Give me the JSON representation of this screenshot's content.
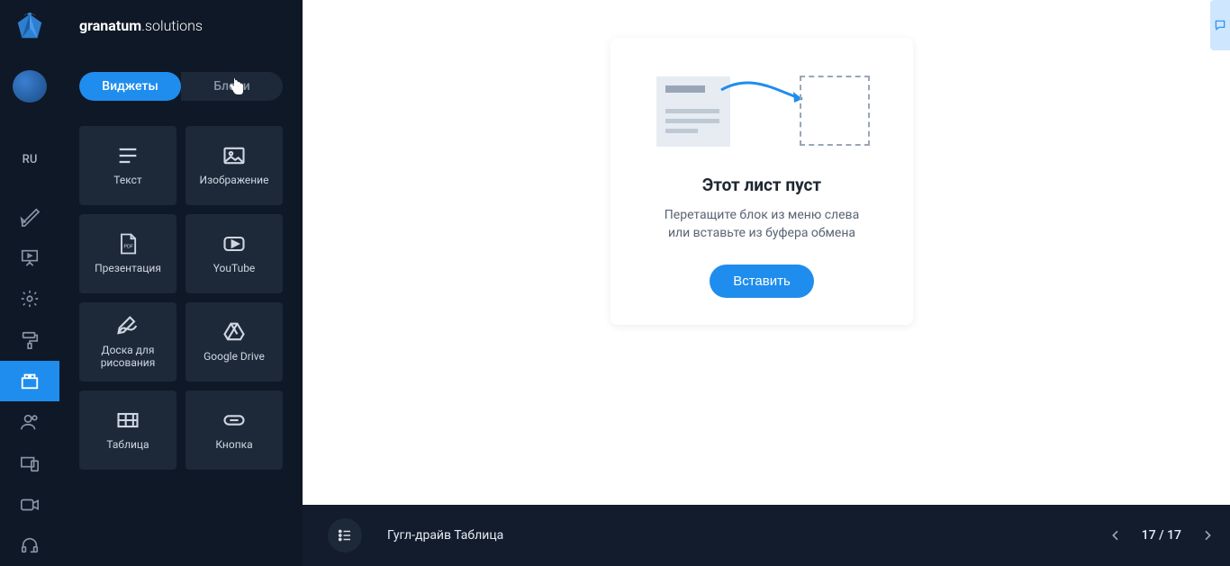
{
  "brand": {
    "bold_part": "granatum",
    "light_part": ".solutions"
  },
  "rail": {
    "lang": "RU"
  },
  "panel": {
    "tabs": {
      "widgets": "Виджеты",
      "blocks": "Блоки"
    },
    "widgets": [
      {
        "label": "Текст"
      },
      {
        "label": "Изображение"
      },
      {
        "label": "Презентация"
      },
      {
        "label": "YouTube"
      },
      {
        "label": "Доска для рисования"
      },
      {
        "label": "Google Drive"
      },
      {
        "label": "Таблица"
      },
      {
        "label": "Кнопка"
      }
    ]
  },
  "empty": {
    "title": "Этот лист пуст",
    "subtitle_line1": "Перетащите блок из меню слева",
    "subtitle_line2": "или вставьте из буфера обмена",
    "button": "Вставить"
  },
  "bottom": {
    "title": "Гугл-драйв Таблица",
    "counter": "17 / 17"
  }
}
